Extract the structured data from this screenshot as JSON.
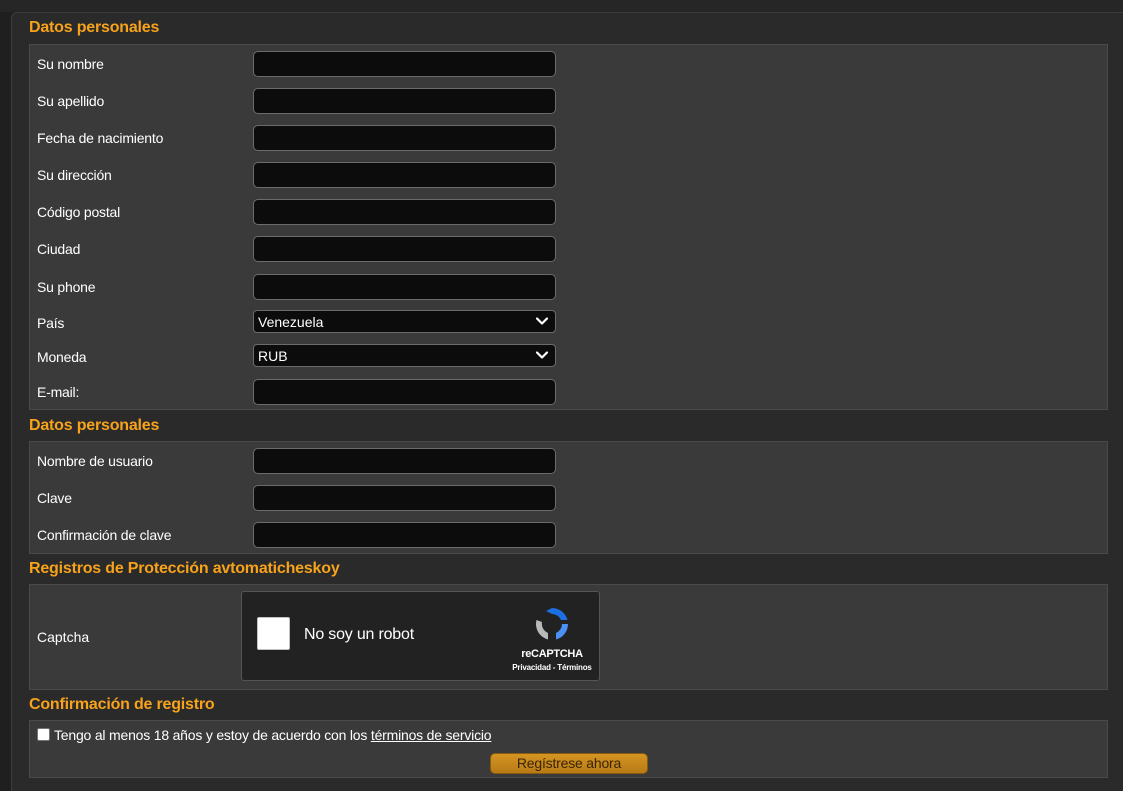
{
  "sections": {
    "personal": {
      "title": "Datos personales",
      "fields": [
        {
          "label": "Su nombre",
          "value": ""
        },
        {
          "label": "Su apellido",
          "value": ""
        },
        {
          "label": "Fecha de nacimiento",
          "value": ""
        },
        {
          "label": "Su dirección",
          "value": ""
        },
        {
          "label": "Código postal",
          "value": ""
        },
        {
          "label": "Ciudad",
          "value": ""
        },
        {
          "label": "Su phone",
          "value": ""
        }
      ],
      "country": {
        "label": "País",
        "selected": "Venezuela"
      },
      "currency": {
        "label": "Moneda",
        "selected": "RUB"
      },
      "email": {
        "label": "E-mail:",
        "value": ""
      }
    },
    "account": {
      "title": "Datos personales",
      "fields": [
        {
          "label": "Nombre de usuario",
          "value": ""
        },
        {
          "label": "Clave",
          "value": ""
        },
        {
          "label": "Confirmación de clave",
          "value": ""
        }
      ]
    },
    "protection": {
      "title": "Registros de Protección avtomaticheskoy",
      "captcha_label": "Captcha",
      "captcha_text": "No soy un robot",
      "recaptcha_name": "reCAPTCHA",
      "recaptcha_links": "Privacidad - Términos"
    },
    "confirm": {
      "title": "Confirmación de registro",
      "terms_prefix": "Tengo al menos 18 años y estoy de acuerdo con los ",
      "terms_link": "términos de servicio",
      "submit_label": "Regístrese ahora"
    }
  },
  "colors": {
    "accent": "#f7a21b",
    "panel": "#3a3a3a",
    "input": "#0c0c0c",
    "button": "#d49521"
  }
}
